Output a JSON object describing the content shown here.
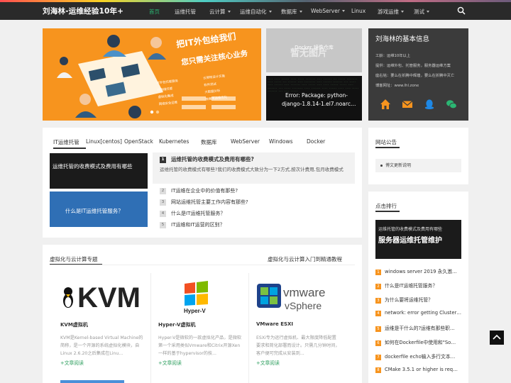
{
  "nav": {
    "brand": "刘海林-运维经验10年+",
    "items": [
      {
        "label": "首页",
        "active": true
      },
      {
        "label": "运维托管"
      },
      {
        "label": "云计算",
        "dropdown": true
      },
      {
        "label": "运维自动化",
        "dropdown": true
      },
      {
        "label": "数据库",
        "dropdown": true
      },
      {
        "label": "WebServer",
        "dropdown": true
      },
      {
        "label": "Linux"
      },
      {
        "label": "游戏运维",
        "dropdown": true
      },
      {
        "label": "测试",
        "dropdown": true
      }
    ]
  },
  "banner": {
    "headline1": "把IT外包给我们",
    "headline2": "您只需关注核心业务",
    "services": [
      "IT外包托管服务",
      "云架构设计实施",
      "IT运维托管",
      "软件测试",
      "虚拟化集成",
      "大数据分析",
      "网络安全运维",
      "数据库运维优化"
    ]
  },
  "thumbs": {
    "top_label": "Docker 镜像仓库",
    "top_watermark": "暂无图片",
    "bottom_line1": "Error: Package: python-",
    "bottom_line2": "django-1.8.14-1.el7.noarc…"
  },
  "profile": {
    "title": "刘海林的基本信息",
    "lines": [
      "工龄：运维10年以上",
      "提供：运维外包、托管服务，服务器运维方案",
      "座右铭：要么在折腾中辉煌，要么在折腾中灭亡",
      "博客网址：www.lhl.zone"
    ],
    "icons": [
      "home-icon",
      "mail-icon",
      "qq-icon",
      "wechat-icon"
    ]
  },
  "tabs": [
    "IT运维托管",
    "Linux[centos]",
    "OpenStack",
    "Kubernetes",
    "数据库",
    "WebServer",
    "Windows",
    "Docker"
  ],
  "featured": {
    "img1_text": "运维托管的收费模式及费用有哪些",
    "img2_text": "什么是IT运维托管服务？",
    "top_title": "运维托管的收费模式及费用有哪些?",
    "top_desc": "运维托管的收费模式有哪些?我们的收费模式大致分为一下2方式,按次计费用,包月收费模式",
    "list": [
      {
        "num": "2",
        "title": "IT运维在企业中的价值有那些?"
      },
      {
        "num": "3",
        "title": "网站运维托管主要工作内容有那些?"
      },
      {
        "num": "4",
        "title": "什么是IT运维托管服务？"
      },
      {
        "num": "5",
        "title": "IT运维和IT运营的区别？"
      }
    ]
  },
  "virt": {
    "section_title": "虚拟化与云计算专题",
    "section_link": "虚拟化与云计算入门到精通教程",
    "read_more": "+文章阅读",
    "cards": [
      {
        "logo": "KVM",
        "title": "KVM虚拟机",
        "desc": "KVM是Kernel-based Virtual Machine的简称，是一个开源的系统虚拟化模块，自Linux 2.6.20之后集成在Linu..."
      },
      {
        "logo": "Hyper-V",
        "title": "Hyper-V虚拟机",
        "desc": "Hyper-V是微软的一款虚拟化产品，是微软第一个采用类似Vmware和Citrix开源Xen一样的基于hypervisor的技..."
      },
      {
        "logo": "vmware vSphere",
        "title": "VMware ESXI",
        "desc": "ESXi专为运行虚拟机、最大限度降低配置要求和简化部署而设计。只需几分钟时间，客户便可完成从安装到..."
      }
    ]
  },
  "notice": {
    "title": "网站公告",
    "items": [
      "博文更新说明"
    ]
  },
  "ranking": {
    "title": "点击排行",
    "image_text": "服务器运维托管维护",
    "image_caption": "运维托管的收费模式及费用有哪些",
    "items": [
      {
        "num": "1",
        "title": "windows server 2019 永久激…"
      },
      {
        "num": "2",
        "title": "什么是IT运维托管服务？"
      },
      {
        "num": "3",
        "title": "为什么要将运维托管？"
      },
      {
        "num": "4",
        "title": "network: error getting Cluster…"
      },
      {
        "num": "5",
        "title": "运维是干什么的?运维有那些职…"
      },
      {
        "num": "6",
        "title": "如何在Dockerfile中使用和\"So…"
      },
      {
        "num": "7",
        "title": "dockerfile echo输入多行文本…"
      },
      {
        "num": "8",
        "title": "CMake 3.5.1 or higher is req…"
      }
    ]
  },
  "colors": {
    "navbar": "#2a2a2a",
    "accent_green": "#2bb673",
    "banner_orange": "#f7941e",
    "rank_orange": "#f7941e",
    "profile_bg": "#3b3b3b"
  }
}
